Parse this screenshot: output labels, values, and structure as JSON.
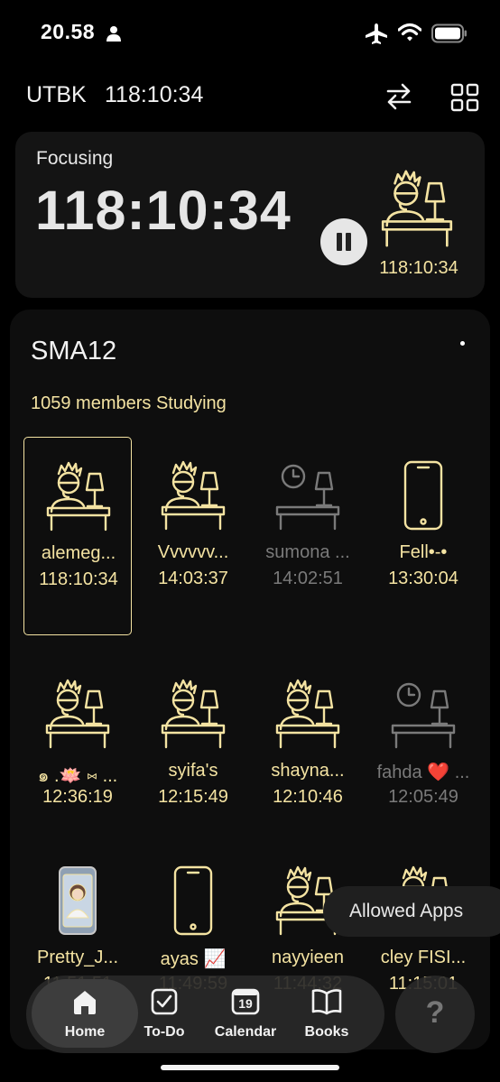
{
  "status_bar": {
    "time": "20.58",
    "icons": [
      "person-icon",
      "airplane-icon",
      "wifi-icon",
      "battery-icon"
    ]
  },
  "header": {
    "title": "UTBK",
    "timer": "118:10:34",
    "icons": [
      "swap-icon",
      "grid-icon"
    ]
  },
  "focus_card": {
    "label": "Focusing",
    "elapsed": "118:10:34",
    "avatar_time": "118:10:34",
    "pause_icon": "pause-icon"
  },
  "group": {
    "name": "SMA12",
    "members_studying": "1059 members Studying",
    "members": [
      {
        "name": "alemeg...",
        "time": "118:10:34",
        "icon": "studying-desk-icon",
        "status": "active",
        "selected": true
      },
      {
        "name": "Vvvvvv...",
        "time": "14:03:37",
        "icon": "studying-desk-icon",
        "status": "active"
      },
      {
        "name": "sumona ...",
        "time": "14:02:51",
        "icon": "idle-desk-icon",
        "status": "inactive"
      },
      {
        "name": "Fell•-•",
        "time": "13:30:04",
        "icon": "phone-icon",
        "status": "active"
      },
      {
        "name": "๑ .🪷 ⑅ ...",
        "time": "12:36:19",
        "icon": "studying-desk-icon",
        "status": "active"
      },
      {
        "name": "syifa's",
        "time": "12:15:49",
        "icon": "studying-desk-icon",
        "status": "active"
      },
      {
        "name": "shayna...",
        "time": "12:10:46",
        "icon": "studying-desk-icon",
        "status": "active"
      },
      {
        "name": "fahda ❤️ ...",
        "time": "12:05:49",
        "icon": "idle-desk-icon",
        "status": "inactive"
      },
      {
        "name": "Pretty_J...",
        "time": "11:51:51",
        "icon": "photo-phone-icon",
        "status": "active"
      },
      {
        "name": "ayas 📈",
        "time": "11:49:59",
        "icon": "phone-icon",
        "status": "active"
      },
      {
        "name": "nayyieen",
        "time": "11:44:32",
        "icon": "studying-desk-icon",
        "status": "active"
      },
      {
        "name": "cley FISI...",
        "time": "11:15:01",
        "icon": "studying-desk-icon",
        "status": "active"
      }
    ]
  },
  "allowed_apps": "Allowed Apps",
  "nav": {
    "items": [
      {
        "label": "Home",
        "icon": "home-icon",
        "active": true
      },
      {
        "label": "To-Do",
        "icon": "checkbox-icon"
      },
      {
        "label": "Calendar",
        "icon": "calendar-icon",
        "day": "19"
      },
      {
        "label": "Books",
        "icon": "book-icon"
      }
    ],
    "help": "?"
  },
  "colors": {
    "accent": "#f4e3a2",
    "inactive": "#7a7a7a",
    "card": "#141414",
    "background": "#000000"
  }
}
